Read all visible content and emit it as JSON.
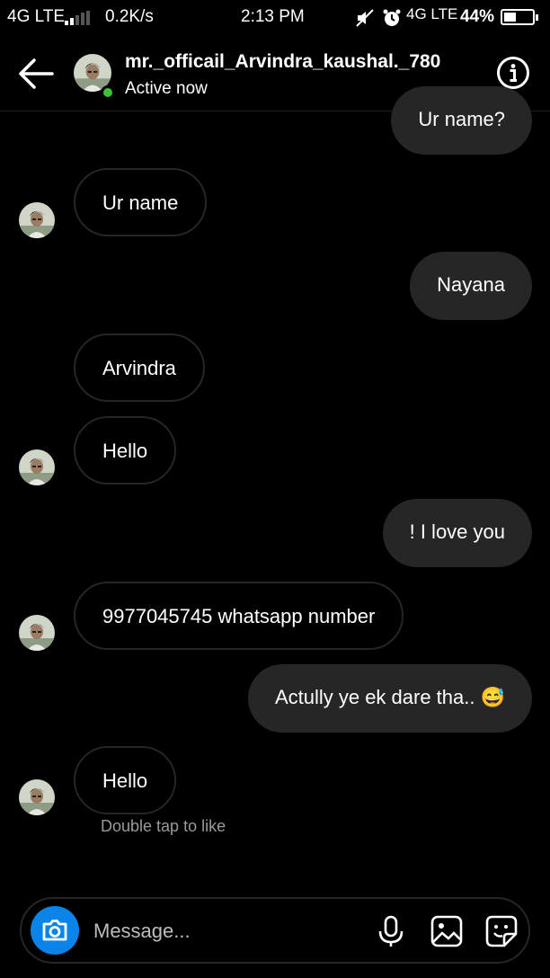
{
  "status_bar": {
    "network_left": "4G LTE",
    "speed": "0.2K/s",
    "time": "2:13 PM",
    "network_right": "4G LTE",
    "battery": "44%"
  },
  "header": {
    "username": "mr._officail_Arvindra_kaushal._780",
    "status": "Active now"
  },
  "messages": [
    {
      "side": "out",
      "text": "Ur name?"
    },
    {
      "side": "in",
      "text": "Ur name"
    },
    {
      "side": "out",
      "text": "Nayana"
    },
    {
      "side": "in",
      "text": "Arvindra"
    },
    {
      "side": "in",
      "text": "Hello"
    },
    {
      "side": "out",
      "text": "! I love you"
    },
    {
      "side": "in",
      "text": "9977045745 whatsapp number"
    },
    {
      "side": "out",
      "text": "Actully ye ek dare tha.. 😅"
    },
    {
      "side": "in",
      "text": "Hello"
    }
  ],
  "hint": "Double tap to like",
  "composer": {
    "placeholder": "Message..."
  },
  "colors": {
    "background": "#000000",
    "bubble_out": "#262626",
    "bubble_in_border": "#262626",
    "online": "#3cc03c",
    "camera": "#0a84e8"
  },
  "icons": [
    "back-arrow-icon",
    "info-icon",
    "camera-icon",
    "microphone-icon",
    "image-icon",
    "sticker-icon"
  ]
}
